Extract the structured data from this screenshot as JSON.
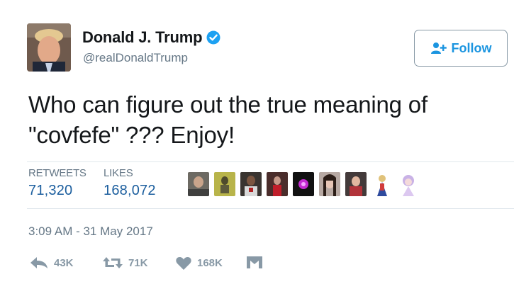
{
  "author": {
    "display_name": "Donald J. Trump",
    "handle": "@realDonaldTrump",
    "verified": true,
    "verified_color": "#1da1f2"
  },
  "follow_button": {
    "label": "Follow",
    "icon": "add-user-icon",
    "color": "#1b95e0"
  },
  "tweet": {
    "text_line1": "Who can figure out the true meaning of",
    "text_line2": "\"covfefe\" ???  Enjoy!"
  },
  "stats": {
    "retweets_label": "RETWEETS",
    "retweets_value": "71,320",
    "likes_label": "LIKES",
    "likes_value": "168,072"
  },
  "likers_count_shown": 9,
  "timestamp": "3:09 AM - 31 May 2017",
  "actions": {
    "reply_count": "43K",
    "retweet_count": "71K",
    "like_count": "168K",
    "dm_icon": "envelope-icon"
  },
  "colors": {
    "link": "#1b5e9e",
    "muted": "#657786",
    "action_gray": "#8899a6"
  }
}
